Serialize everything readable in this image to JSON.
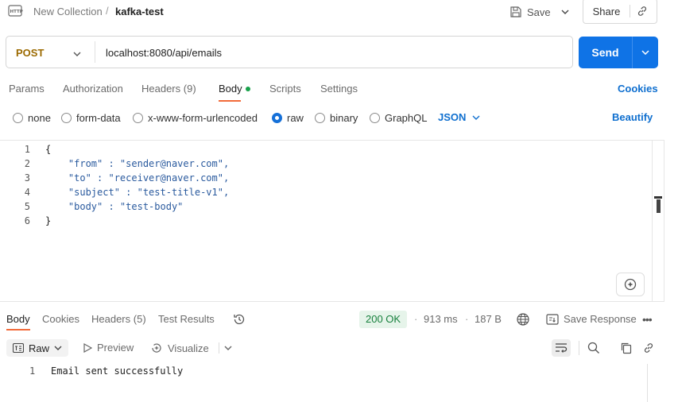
{
  "header": {
    "collection": "New Collection",
    "separator": "/",
    "request_name": "kafka-test",
    "save_label": "Save",
    "share_label": "Share"
  },
  "request": {
    "method": "POST",
    "url": "localhost:8080/api/emails",
    "send_label": "Send"
  },
  "request_tabs": {
    "params": "Params",
    "authorization": "Authorization",
    "headers": "Headers",
    "headers_count": "(9)",
    "body": "Body",
    "scripts": "Scripts",
    "settings": "Settings",
    "cookies": "Cookies"
  },
  "body_types": {
    "none": "none",
    "form_data": "form-data",
    "urlencoded": "x-www-form-urlencoded",
    "raw": "raw",
    "binary": "binary",
    "graphql": "GraphQL",
    "format": "JSON",
    "beautify": "Beautify",
    "selected": "raw"
  },
  "editor": {
    "line_numbers": [
      "1",
      "2",
      "3",
      "4",
      "5",
      "6"
    ],
    "lines": [
      "{",
      "    \"from\" : \"sender@naver.com\",",
      "    \"to\" : \"receiver@naver.com\",",
      "    \"subject\" : \"test-title-v1\",",
      "    \"body\" : \"test-body\"",
      "}"
    ]
  },
  "response_tabs": {
    "body": "Body",
    "cookies": "Cookies",
    "headers": "Headers",
    "headers_count": "(5)",
    "test_results": "Test Results"
  },
  "response_meta": {
    "status": "200 OK",
    "time": "913 ms",
    "size": "187 B",
    "dot": "·",
    "save_response": "Save Response"
  },
  "response_toolbar": {
    "raw": "Raw",
    "preview": "Preview",
    "visualize": "Visualize"
  },
  "response_body": {
    "line_number": "1",
    "text": "Email sent successfully"
  },
  "colors": {
    "accent": "#0f73e6",
    "method": "#9b6a00",
    "active_tab": "#f26b3a",
    "status_ok": "#17803d",
    "dot": "#17a14a"
  }
}
